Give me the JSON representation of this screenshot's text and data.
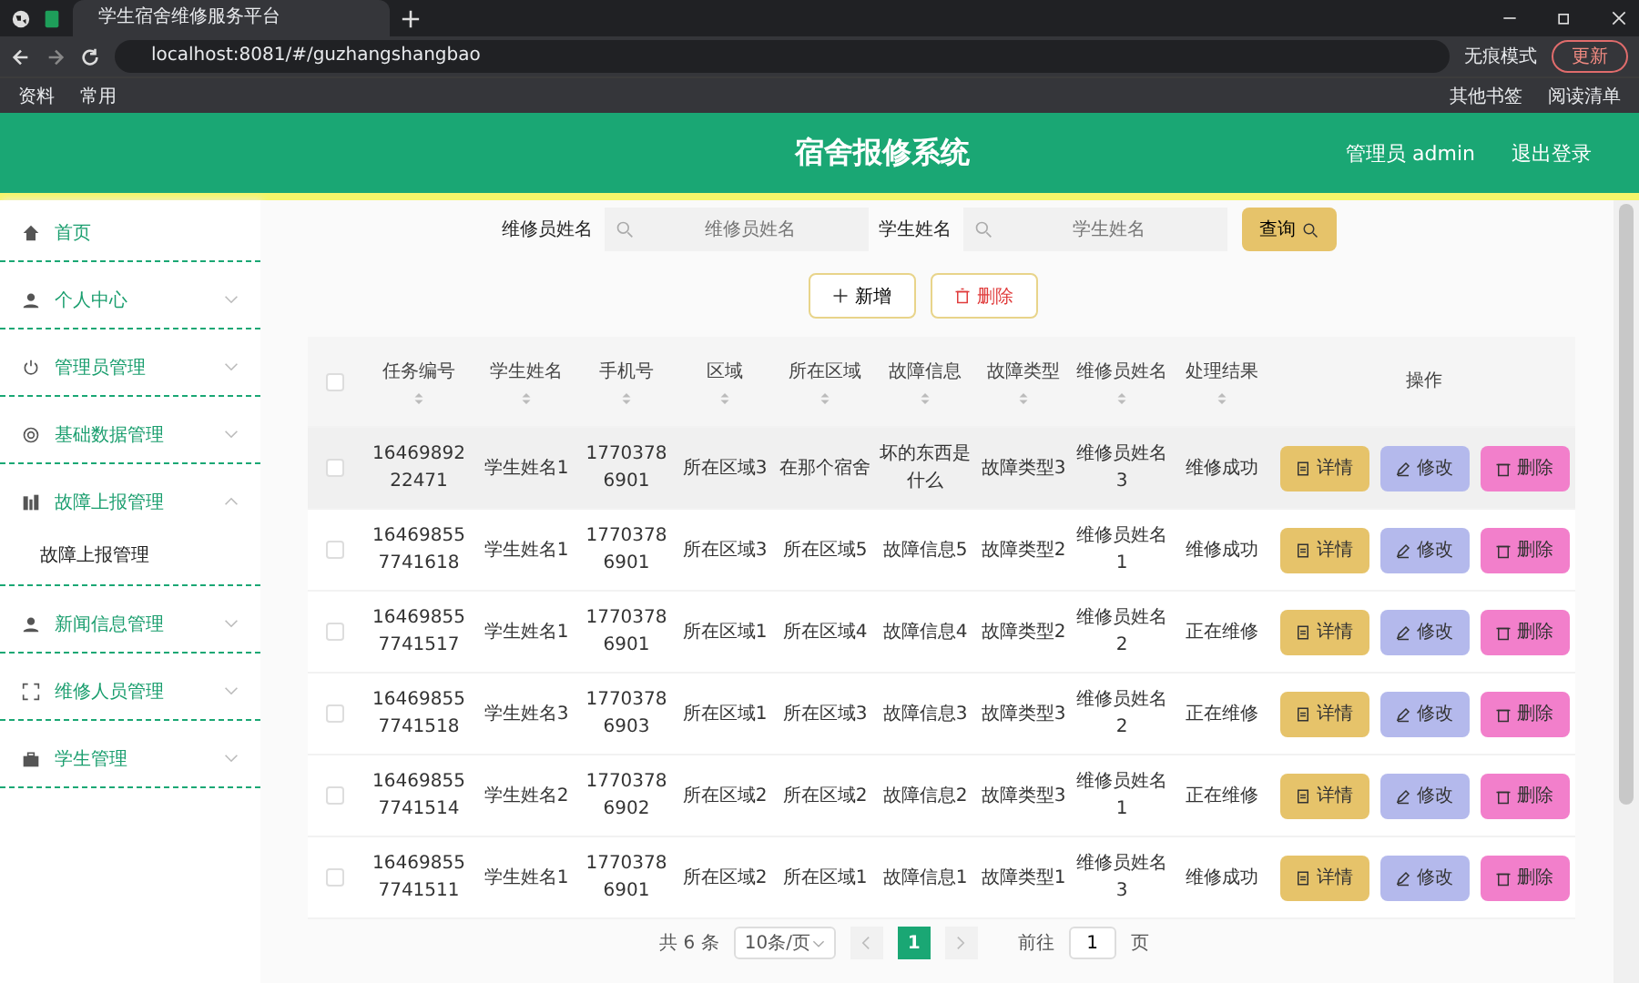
{
  "browser": {
    "tabs": [
      {
        "title": "学生宿舍维修服务平台",
        "selected": true
      }
    ],
    "address": "localhost:8081/#/guzhangshangbao",
    "incognito": "无痕模式",
    "update": "更新",
    "bookmarks": [
      "资料",
      "常用"
    ],
    "bookmarks_right": [
      "其他书签",
      "阅读清单"
    ]
  },
  "header": {
    "title": "宿舍报修系统",
    "user": "管理员 admin",
    "logout": "退出登录"
  },
  "sidebar": {
    "items": [
      {
        "label": "首页"
      },
      {
        "label": "个人中心",
        "expanded": false
      },
      {
        "label": "管理员管理",
        "expanded": false
      },
      {
        "label": "基础数据管理",
        "expanded": false
      },
      {
        "label": "故障上报管理",
        "expanded": true,
        "children": [
          {
            "label": "故障上报管理",
            "selected": true
          }
        ]
      },
      {
        "label": "新闻信息管理",
        "expanded": false
      },
      {
        "label": "维修人员管理",
        "expanded": false
      },
      {
        "label": "学生管理",
        "expanded": false
      }
    ]
  },
  "search": {
    "fields": [
      {
        "label": "维修员姓名",
        "placeholder": "维修员姓名"
      },
      {
        "label": "学生姓名",
        "placeholder": "学生姓名"
      }
    ],
    "button": "查询"
  },
  "actions": {
    "add": "新增",
    "delete": "删除"
  },
  "table": {
    "select_all": {
      "checked": false
    },
    "columns": [
      {
        "label": "任务编号",
        "sortable": true
      },
      {
        "label": "学生姓名",
        "sortable": true
      },
      {
        "label": "手机号",
        "sortable": true
      },
      {
        "label": "区域",
        "sortable": true
      },
      {
        "label": "所在区域",
        "sortable": true
      },
      {
        "label": "故障信息",
        "sortable": true
      },
      {
        "label": "故障类型",
        "sortable": true
      },
      {
        "label": "维修员姓名",
        "sortable": true
      },
      {
        "label": "处理结果",
        "sortable": true
      },
      {
        "label": "操作",
        "sortable": false
      }
    ],
    "rows": [
      {
        "hovered": true,
        "checked": false,
        "cells": [
          "1646989222471",
          "学生姓名1",
          "17703786901",
          "所在区域3",
          "在那个宿舍",
          "坏的东西是什么",
          "故障类型3",
          "维修员姓名3",
          "维修成功"
        ],
        "buttons": [
          "详情",
          "修改",
          "删除"
        ]
      },
      {
        "hovered": false,
        "checked": false,
        "cells": [
          "16469855 7741618",
          "学生姓名1",
          "17703786901",
          "所在区域3",
          "所在区域5",
          "故障信息5",
          "故障类型2",
          "维修员姓名1",
          "维修成功"
        ],
        "buttons": [
          "详情",
          "修改",
          "删除"
        ]
      },
      {
        "hovered": false,
        "checked": false,
        "cells": [
          "16469855 7741517",
          "学生姓名1",
          "17703786901",
          "所在区域1",
          "所在区域4",
          "故障信息4",
          "故障类型2",
          "维修员姓名2",
          "正在维修"
        ],
        "buttons": [
          "详情",
          "修改",
          "删除"
        ]
      },
      {
        "hovered": false,
        "checked": false,
        "cells": [
          "16469855 7741518",
          "学生姓名3",
          "17703786903",
          "所在区域1",
          "所在区域3",
          "故障信息3",
          "故障类型3",
          "维修员姓名2",
          "正在维修"
        ],
        "buttons": [
          "详情",
          "修改",
          "删除"
        ]
      },
      {
        "hovered": false,
        "checked": false,
        "cells": [
          "16469855 7741514",
          "学生姓名2",
          "17703786902",
          "所在区域2",
          "所在区域2",
          "故障信息2",
          "故障类型3",
          "维修员姓名1",
          "正在维修"
        ],
        "buttons": [
          "详情",
          "修改",
          "删除"
        ]
      },
      {
        "hovered": false,
        "checked": false,
        "cells": [
          "16469855 7741511",
          "学生姓名1",
          "17703786901",
          "所在区域2",
          "所在区域1",
          "故障信息1",
          "故障类型1",
          "维修员姓名3",
          "维修成功"
        ],
        "buttons": [
          "详情",
          "修改",
          "删除"
        ]
      }
    ]
  },
  "pagination": {
    "total": "共 6 条",
    "page_size": "10条/页",
    "pages": [
      {
        "label": "1",
        "selected": true
      }
    ],
    "goto_label": "前往",
    "goto_value": "1",
    "goto_suffix": "页"
  }
}
